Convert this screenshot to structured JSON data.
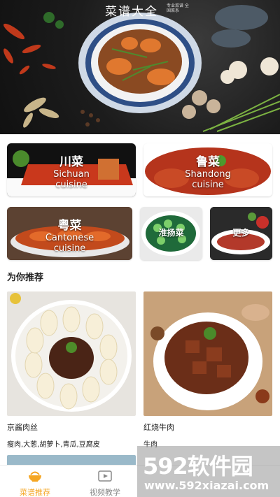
{
  "hero": {
    "title": "菜谱大全",
    "subtitle": "专业菜谱 全国菜系"
  },
  "categories": [
    {
      "zh": "川菜",
      "en": "Sichuan cuisine"
    },
    {
      "zh": "鲁菜",
      "en": "Shandong cuisine"
    },
    {
      "zh": "粤菜",
      "en": "Cantonese cuisine"
    },
    {
      "zh": "淮扬菜",
      "en": ""
    },
    {
      "zh": "更多",
      "en": ""
    }
  ],
  "section": {
    "title": "为你推荐"
  },
  "recommendations": [
    {
      "name": "京酱肉丝",
      "ingredients": "瘦肉,大葱,胡萝卜,青瓜,豆腐皮"
    },
    {
      "name": "红烧牛肉",
      "ingredients": "牛肉"
    }
  ],
  "tabs": [
    {
      "label": "菜谱推荐",
      "icon": "bowl-icon",
      "active": true
    },
    {
      "label": "视频教学",
      "icon": "video-icon",
      "active": false
    }
  ],
  "watermark": {
    "logo": "592软件园",
    "url": "www.592xiazai.com"
  },
  "colors": {
    "accent": "#f5a623",
    "inactive": "#888888"
  }
}
